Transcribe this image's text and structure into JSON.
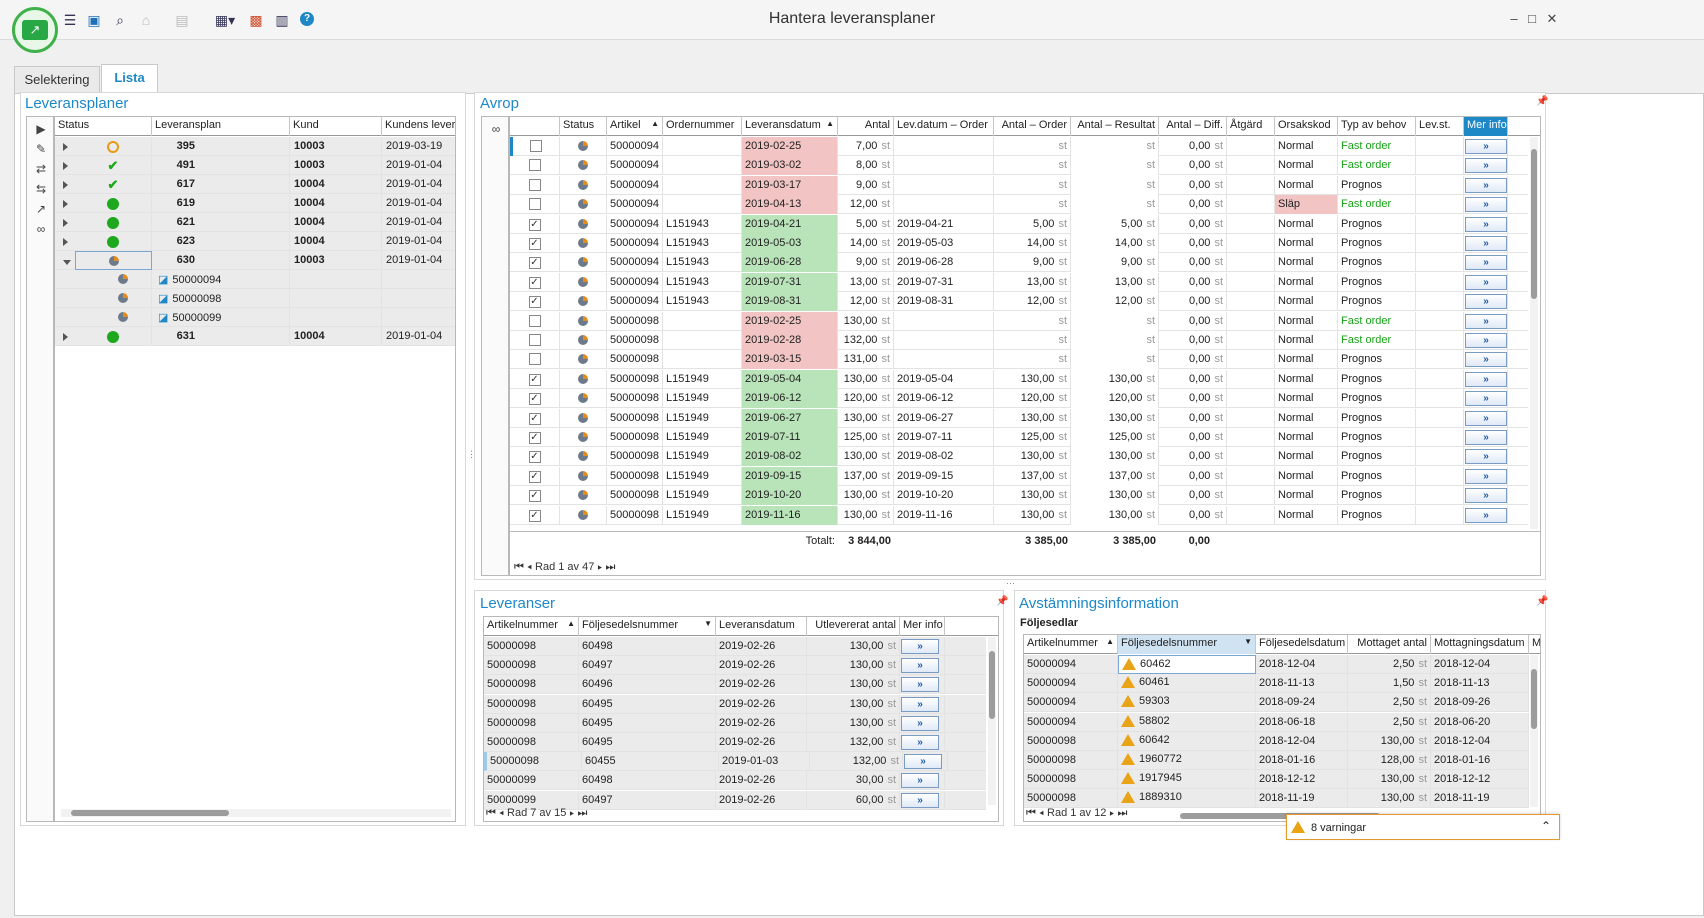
{
  "window": {
    "title": "Hantera leveransplaner"
  },
  "tabs": [
    {
      "label": "Selektering"
    },
    {
      "label": "Lista"
    }
  ],
  "leveransplaner": {
    "title": "Leveransplaner",
    "columns": [
      "Status",
      "Leveransplan",
      "Kund",
      "Kundens leveran"
    ],
    "rows": [
      {
        "status": "clock",
        "plan": "395",
        "kund": "10003",
        "date": "2019-03-19"
      },
      {
        "status": "check",
        "plan": "491",
        "kund": "10003",
        "date": "2019-01-04"
      },
      {
        "status": "check",
        "plan": "617",
        "kund": "10004",
        "date": "2019-01-04"
      },
      {
        "status": "dot",
        "plan": "619",
        "kund": "10004",
        "date": "2019-01-04"
      },
      {
        "status": "dot",
        "plan": "621",
        "kund": "10004",
        "date": "2019-01-04"
      },
      {
        "status": "dot",
        "plan": "623",
        "kund": "10004",
        "date": "2019-01-04"
      },
      {
        "status": "pie",
        "plan": "630",
        "kund": "10003",
        "date": "2019-01-04",
        "expanded": true,
        "children": [
          "50000094",
          "50000098",
          "50000099"
        ]
      },
      {
        "status": "dot",
        "plan": "631",
        "kund": "10004",
        "date": "2019-01-04"
      }
    ]
  },
  "avrop": {
    "title": "Avrop",
    "columns": [
      "Status",
      "Artikel",
      "Ordernummer",
      "Leveransdatum",
      "Antal",
      "Lev.datum – Order",
      "Antal – Order",
      "Antal – Resultat",
      "Antal – Diff.",
      "Åtgärd",
      "Orsakskod",
      "Typ av behov",
      "Lev.st.",
      "Mer info"
    ],
    "unit": "st",
    "rows": [
      {
        "checked": false,
        "artikel": "50000094",
        "order": "",
        "levdatum": "2019-02-25",
        "color": "red",
        "antal": "7,00",
        "levorder": "",
        "antalorder": "",
        "resultat": "",
        "diff": "0,00",
        "orsak": "Normal",
        "typ": "Fast order"
      },
      {
        "checked": false,
        "artikel": "50000094",
        "order": "",
        "levdatum": "2019-03-02",
        "color": "red",
        "antal": "8,00",
        "levorder": "",
        "antalorder": "",
        "resultat": "",
        "diff": "0,00",
        "orsak": "Normal",
        "typ": "Fast order"
      },
      {
        "checked": false,
        "artikel": "50000094",
        "order": "",
        "levdatum": "2019-03-17",
        "color": "red",
        "antal": "9,00",
        "levorder": "",
        "antalorder": "",
        "resultat": "",
        "diff": "0,00",
        "orsak": "Normal",
        "typ": "Prognos"
      },
      {
        "checked": false,
        "artikel": "50000094",
        "order": "",
        "levdatum": "2019-04-13",
        "color": "red",
        "antal": "12,00",
        "levorder": "",
        "antalorder": "",
        "resultat": "",
        "diff": "0,00",
        "orsak": "Släp",
        "typ": "Fast order"
      },
      {
        "checked": true,
        "artikel": "50000094",
        "order": "L151943",
        "levdatum": "2019-04-21",
        "color": "green",
        "antal": "5,00",
        "levorder": "2019-04-21",
        "antalorder": "5,00",
        "resultat": "5,00",
        "diff": "0,00",
        "orsak": "Normal",
        "typ": "Prognos"
      },
      {
        "checked": true,
        "artikel": "50000094",
        "order": "L151943",
        "levdatum": "2019-05-03",
        "color": "green",
        "antal": "14,00",
        "levorder": "2019-05-03",
        "antalorder": "14,00",
        "resultat": "14,00",
        "diff": "0,00",
        "orsak": "Normal",
        "typ": "Prognos"
      },
      {
        "checked": true,
        "artikel": "50000094",
        "order": "L151943",
        "levdatum": "2019-06-28",
        "color": "green",
        "antal": "9,00",
        "levorder": "2019-06-28",
        "antalorder": "9,00",
        "resultat": "9,00",
        "diff": "0,00",
        "orsak": "Normal",
        "typ": "Prognos"
      },
      {
        "checked": true,
        "artikel": "50000094",
        "order": "L151943",
        "levdatum": "2019-07-31",
        "color": "green",
        "antal": "13,00",
        "levorder": "2019-07-31",
        "antalorder": "13,00",
        "resultat": "13,00",
        "diff": "0,00",
        "orsak": "Normal",
        "typ": "Prognos"
      },
      {
        "checked": true,
        "artikel": "50000094",
        "order": "L151943",
        "levdatum": "2019-08-31",
        "color": "green",
        "antal": "12,00",
        "levorder": "2019-08-31",
        "antalorder": "12,00",
        "resultat": "12,00",
        "diff": "0,00",
        "orsak": "Normal",
        "typ": "Prognos"
      },
      {
        "checked": false,
        "artikel": "50000098",
        "order": "",
        "levdatum": "2019-02-25",
        "color": "red",
        "antal": "130,00",
        "levorder": "",
        "antalorder": "",
        "resultat": "",
        "diff": "0,00",
        "orsak": "Normal",
        "typ": "Fast order"
      },
      {
        "checked": false,
        "artikel": "50000098",
        "order": "",
        "levdatum": "2019-02-28",
        "color": "red",
        "antal": "132,00",
        "levorder": "",
        "antalorder": "",
        "resultat": "",
        "diff": "0,00",
        "orsak": "Normal",
        "typ": "Fast order"
      },
      {
        "checked": false,
        "artikel": "50000098",
        "order": "",
        "levdatum": "2019-03-15",
        "color": "red",
        "antal": "131,00",
        "levorder": "",
        "antalorder": "",
        "resultat": "",
        "diff": "0,00",
        "orsak": "Normal",
        "typ": "Prognos"
      },
      {
        "checked": true,
        "artikel": "50000098",
        "order": "L151949",
        "levdatum": "2019-05-04",
        "color": "green",
        "antal": "130,00",
        "levorder": "2019-05-04",
        "antalorder": "130,00",
        "resultat": "130,00",
        "diff": "0,00",
        "orsak": "Normal",
        "typ": "Prognos"
      },
      {
        "checked": true,
        "artikel": "50000098",
        "order": "L151949",
        "levdatum": "2019-06-12",
        "color": "green",
        "antal": "120,00",
        "levorder": "2019-06-12",
        "antalorder": "120,00",
        "resultat": "120,00",
        "diff": "0,00",
        "orsak": "Normal",
        "typ": "Prognos"
      },
      {
        "checked": true,
        "artikel": "50000098",
        "order": "L151949",
        "levdatum": "2019-06-27",
        "color": "green",
        "antal": "130,00",
        "levorder": "2019-06-27",
        "antalorder": "130,00",
        "resultat": "130,00",
        "diff": "0,00",
        "orsak": "Normal",
        "typ": "Prognos"
      },
      {
        "checked": true,
        "artikel": "50000098",
        "order": "L151949",
        "levdatum": "2019-07-11",
        "color": "green",
        "antal": "125,00",
        "levorder": "2019-07-11",
        "antalorder": "125,00",
        "resultat": "125,00",
        "diff": "0,00",
        "orsak": "Normal",
        "typ": "Prognos"
      },
      {
        "checked": true,
        "artikel": "50000098",
        "order": "L151949",
        "levdatum": "2019-08-02",
        "color": "green",
        "antal": "130,00",
        "levorder": "2019-08-02",
        "antalorder": "130,00",
        "resultat": "130,00",
        "diff": "0,00",
        "orsak": "Normal",
        "typ": "Prognos"
      },
      {
        "checked": true,
        "artikel": "50000098",
        "order": "L151949",
        "levdatum": "2019-09-15",
        "color": "green",
        "antal": "137,00",
        "levorder": "2019-09-15",
        "antalorder": "137,00",
        "resultat": "137,00",
        "diff": "0,00",
        "orsak": "Normal",
        "typ": "Prognos"
      },
      {
        "checked": true,
        "artikel": "50000098",
        "order": "L151949",
        "levdatum": "2019-10-20",
        "color": "green",
        "antal": "130,00",
        "levorder": "2019-10-20",
        "antalorder": "130,00",
        "resultat": "130,00",
        "diff": "0,00",
        "orsak": "Normal",
        "typ": "Prognos"
      },
      {
        "checked": true,
        "artikel": "50000098",
        "order": "L151949",
        "levdatum": "2019-11-16",
        "color": "green",
        "antal": "130,00",
        "levorder": "2019-11-16",
        "antalorder": "130,00",
        "resultat": "130,00",
        "diff": "0,00",
        "orsak": "Normal",
        "typ": "Prognos"
      }
    ],
    "totals": {
      "label": "Totalt:",
      "antal": "3 844,00",
      "antalorder": "3 385,00",
      "resultat": "3 385,00",
      "diff": "0,00"
    },
    "pager": "Rad 1 av 47"
  },
  "leveranser": {
    "title": "Leveranser",
    "columns": [
      "Artikelnummer",
      "Följesedelsnummer",
      "Leveransdatum",
      "Utlevererat antal",
      "Mer info"
    ],
    "rows": [
      {
        "art": "50000098",
        "fs": "60498",
        "date": "2019-02-26",
        "antal": "130,00"
      },
      {
        "art": "50000098",
        "fs": "60497",
        "date": "2019-02-26",
        "antal": "130,00"
      },
      {
        "art": "50000098",
        "fs": "60496",
        "date": "2019-02-26",
        "antal": "130,00"
      },
      {
        "art": "50000098",
        "fs": "60495",
        "date": "2019-02-26",
        "antal": "130,00"
      },
      {
        "art": "50000098",
        "fs": "60495",
        "date": "2019-02-26",
        "antal": "130,00"
      },
      {
        "art": "50000098",
        "fs": "60495",
        "date": "2019-02-26",
        "antal": "132,00"
      },
      {
        "art": "50000098",
        "fs": "60455",
        "date": "2019-01-03",
        "antal": "132,00"
      },
      {
        "art": "50000099",
        "fs": "60498",
        "date": "2019-02-26",
        "antal": "30,00"
      },
      {
        "art": "50000099",
        "fs": "60497",
        "date": "2019-02-26",
        "antal": "60,00"
      }
    ],
    "pager": "Rad 7 av 15"
  },
  "avstamning": {
    "title": "Avstämningsinformation",
    "subtitle": "Följesedlar",
    "columns": [
      "Artikelnummer",
      "Följesedelsnummer",
      "Följesedelsdatum",
      "Mottaget antal",
      "Mottagningsdatum",
      "M"
    ],
    "rows": [
      {
        "art": "50000094",
        "fs": "60462",
        "fsdate": "2018-12-04",
        "antal": "2,50",
        "mdate": "2018-12-04"
      },
      {
        "art": "50000094",
        "fs": "60461",
        "fsdate": "2018-11-13",
        "antal": "1,50",
        "mdate": "2018-11-13"
      },
      {
        "art": "50000094",
        "fs": "59303",
        "fsdate": "2018-09-24",
        "antal": "2,50",
        "mdate": "2018-09-26"
      },
      {
        "art": "50000094",
        "fs": "58802",
        "fsdate": "2018-06-18",
        "antal": "2,50",
        "mdate": "2018-06-20"
      },
      {
        "art": "50000098",
        "fs": "60642",
        "fsdate": "2018-12-04",
        "antal": "130,00",
        "mdate": "2018-12-04"
      },
      {
        "art": "50000098",
        "fs": "1960772",
        "fsdate": "2018-01-16",
        "antal": "128,00",
        "mdate": "2018-01-16"
      },
      {
        "art": "50000098",
        "fs": "1917945",
        "fsdate": "2018-12-12",
        "antal": "130,00",
        "mdate": "2018-12-12"
      },
      {
        "art": "50000098",
        "fs": "1889310",
        "fsdate": "2018-11-19",
        "antal": "130,00",
        "mdate": "2018-11-19"
      }
    ],
    "pager": "Rad 1 av 12"
  },
  "warnings": {
    "label": "8 varningar"
  },
  "colors": {
    "accent": "#1e88c7",
    "late": "#f2c4c4",
    "ontime": "#b9e3b9",
    "fastorder": "#19a319"
  }
}
